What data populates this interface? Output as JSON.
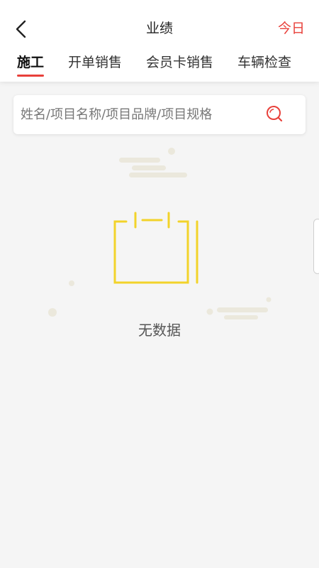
{
  "header": {
    "title": "业绩",
    "back_icon": "chevron-left-icon",
    "today_label": "今日"
  },
  "tabs": [
    {
      "label": "施工",
      "active": true
    },
    {
      "label": "开单销售",
      "active": false
    },
    {
      "label": "会员卡销售",
      "active": false
    },
    {
      "label": "车辆检查",
      "active": false
    }
  ],
  "search": {
    "placeholder": "姓名/项目名称/项目品牌/项目规格",
    "value": "",
    "icon": "search-icon"
  },
  "empty_state": {
    "icon": "empty-clipboard-icon",
    "text": "无数据"
  },
  "colors": {
    "accent": "#e8403a",
    "empty_icon": "#f2d32a",
    "cloud": "#ebe8dc"
  }
}
